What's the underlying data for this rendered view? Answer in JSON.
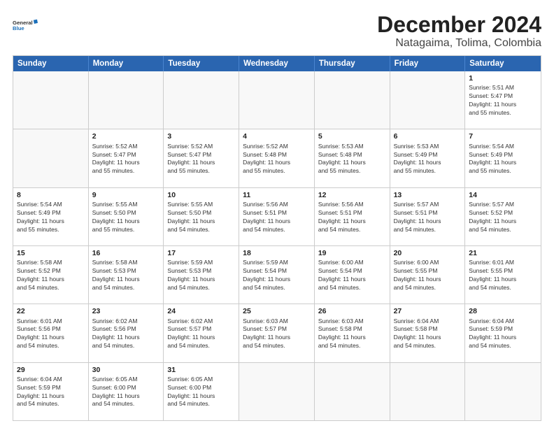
{
  "header": {
    "logo_line1": "General",
    "logo_line2": "Blue",
    "main_title": "December 2024",
    "subtitle": "Natagaima, Tolima, Colombia"
  },
  "calendar": {
    "days_of_week": [
      "Sunday",
      "Monday",
      "Tuesday",
      "Wednesday",
      "Thursday",
      "Friday",
      "Saturday"
    ],
    "weeks": [
      [
        {
          "day": "",
          "empty": true
        },
        {
          "day": "",
          "empty": true
        },
        {
          "day": "",
          "empty": true
        },
        {
          "day": "",
          "empty": true
        },
        {
          "day": "",
          "empty": true
        },
        {
          "day": "",
          "empty": true
        },
        {
          "day": "1",
          "sunrise": "Sunrise: 5:51 AM",
          "sunset": "Sunset: 5:47 PM",
          "daylight": "Daylight: 11 hours",
          "daylight2": "and 55 minutes."
        }
      ],
      [
        {
          "day": "2",
          "sunrise": "Sunrise: 5:52 AM",
          "sunset": "Sunset: 5:47 PM",
          "daylight": "Daylight: 11 hours",
          "daylight2": "and 55 minutes."
        },
        {
          "day": "3",
          "sunrise": "Sunrise: 5:52 AM",
          "sunset": "Sunset: 5:47 PM",
          "daylight": "Daylight: 11 hours",
          "daylight2": "and 55 minutes."
        },
        {
          "day": "4",
          "sunrise": "Sunrise: 5:52 AM",
          "sunset": "Sunset: 5:48 PM",
          "daylight": "Daylight: 11 hours",
          "daylight2": "and 55 minutes."
        },
        {
          "day": "5",
          "sunrise": "Sunrise: 5:53 AM",
          "sunset": "Sunset: 5:48 PM",
          "daylight": "Daylight: 11 hours",
          "daylight2": "and 55 minutes."
        },
        {
          "day": "6",
          "sunrise": "Sunrise: 5:53 AM",
          "sunset": "Sunset: 5:49 PM",
          "daylight": "Daylight: 11 hours",
          "daylight2": "and 55 minutes."
        },
        {
          "day": "7",
          "sunrise": "Sunrise: 5:54 AM",
          "sunset": "Sunset: 5:49 PM",
          "daylight": "Daylight: 11 hours",
          "daylight2": "and 55 minutes."
        }
      ],
      [
        {
          "day": "8",
          "sunrise": "Sunrise: 5:54 AM",
          "sunset": "Sunset: 5:49 PM",
          "daylight": "Daylight: 11 hours",
          "daylight2": "and 55 minutes."
        },
        {
          "day": "9",
          "sunrise": "Sunrise: 5:55 AM",
          "sunset": "Sunset: 5:50 PM",
          "daylight": "Daylight: 11 hours",
          "daylight2": "and 55 minutes."
        },
        {
          "day": "10",
          "sunrise": "Sunrise: 5:55 AM",
          "sunset": "Sunset: 5:50 PM",
          "daylight": "Daylight: 11 hours",
          "daylight2": "and 54 minutes."
        },
        {
          "day": "11",
          "sunrise": "Sunrise: 5:56 AM",
          "sunset": "Sunset: 5:51 PM",
          "daylight": "Daylight: 11 hours",
          "daylight2": "and 54 minutes."
        },
        {
          "day": "12",
          "sunrise": "Sunrise: 5:56 AM",
          "sunset": "Sunset: 5:51 PM",
          "daylight": "Daylight: 11 hours",
          "daylight2": "and 54 minutes."
        },
        {
          "day": "13",
          "sunrise": "Sunrise: 5:57 AM",
          "sunset": "Sunset: 5:51 PM",
          "daylight": "Daylight: 11 hours",
          "daylight2": "and 54 minutes."
        },
        {
          "day": "14",
          "sunrise": "Sunrise: 5:57 AM",
          "sunset": "Sunset: 5:52 PM",
          "daylight": "Daylight: 11 hours",
          "daylight2": "and 54 minutes."
        }
      ],
      [
        {
          "day": "15",
          "sunrise": "Sunrise: 5:58 AM",
          "sunset": "Sunset: 5:52 PM",
          "daylight": "Daylight: 11 hours",
          "daylight2": "and 54 minutes."
        },
        {
          "day": "16",
          "sunrise": "Sunrise: 5:58 AM",
          "sunset": "Sunset: 5:53 PM",
          "daylight": "Daylight: 11 hours",
          "daylight2": "and 54 minutes."
        },
        {
          "day": "17",
          "sunrise": "Sunrise: 5:59 AM",
          "sunset": "Sunset: 5:53 PM",
          "daylight": "Daylight: 11 hours",
          "daylight2": "and 54 minutes."
        },
        {
          "day": "18",
          "sunrise": "Sunrise: 5:59 AM",
          "sunset": "Sunset: 5:54 PM",
          "daylight": "Daylight: 11 hours",
          "daylight2": "and 54 minutes."
        },
        {
          "day": "19",
          "sunrise": "Sunrise: 6:00 AM",
          "sunset": "Sunset: 5:54 PM",
          "daylight": "Daylight: 11 hours",
          "daylight2": "and 54 minutes."
        },
        {
          "day": "20",
          "sunrise": "Sunrise: 6:00 AM",
          "sunset": "Sunset: 5:55 PM",
          "daylight": "Daylight: 11 hours",
          "daylight2": "and 54 minutes."
        },
        {
          "day": "21",
          "sunrise": "Sunrise: 6:01 AM",
          "sunset": "Sunset: 5:55 PM",
          "daylight": "Daylight: 11 hours",
          "daylight2": "and 54 minutes."
        }
      ],
      [
        {
          "day": "22",
          "sunrise": "Sunrise: 6:01 AM",
          "sunset": "Sunset: 5:56 PM",
          "daylight": "Daylight: 11 hours",
          "daylight2": "and 54 minutes."
        },
        {
          "day": "23",
          "sunrise": "Sunrise: 6:02 AM",
          "sunset": "Sunset: 5:56 PM",
          "daylight": "Daylight: 11 hours",
          "daylight2": "and 54 minutes."
        },
        {
          "day": "24",
          "sunrise": "Sunrise: 6:02 AM",
          "sunset": "Sunset: 5:57 PM",
          "daylight": "Daylight: 11 hours",
          "daylight2": "and 54 minutes."
        },
        {
          "day": "25",
          "sunrise": "Sunrise: 6:03 AM",
          "sunset": "Sunset: 5:57 PM",
          "daylight": "Daylight: 11 hours",
          "daylight2": "and 54 minutes."
        },
        {
          "day": "26",
          "sunrise": "Sunrise: 6:03 AM",
          "sunset": "Sunset: 5:58 PM",
          "daylight": "Daylight: 11 hours",
          "daylight2": "and 54 minutes."
        },
        {
          "day": "27",
          "sunrise": "Sunrise: 6:04 AM",
          "sunset": "Sunset: 5:58 PM",
          "daylight": "Daylight: 11 hours",
          "daylight2": "and 54 minutes."
        },
        {
          "day": "28",
          "sunrise": "Sunrise: 6:04 AM",
          "sunset": "Sunset: 5:59 PM",
          "daylight": "Daylight: 11 hours",
          "daylight2": "and 54 minutes."
        }
      ],
      [
        {
          "day": "29",
          "sunrise": "Sunrise: 6:04 AM",
          "sunset": "Sunset: 5:59 PM",
          "daylight": "Daylight: 11 hours",
          "daylight2": "and 54 minutes."
        },
        {
          "day": "30",
          "sunrise": "Sunrise: 6:05 AM",
          "sunset": "Sunset: 6:00 PM",
          "daylight": "Daylight: 11 hours",
          "daylight2": "and 54 minutes."
        },
        {
          "day": "31",
          "sunrise": "Sunrise: 6:05 AM",
          "sunset": "Sunset: 6:00 PM",
          "daylight": "Daylight: 11 hours",
          "daylight2": "and 54 minutes."
        },
        {
          "day": "",
          "empty": true
        },
        {
          "day": "",
          "empty": true
        },
        {
          "day": "",
          "empty": true
        },
        {
          "day": "",
          "empty": true
        }
      ]
    ]
  }
}
